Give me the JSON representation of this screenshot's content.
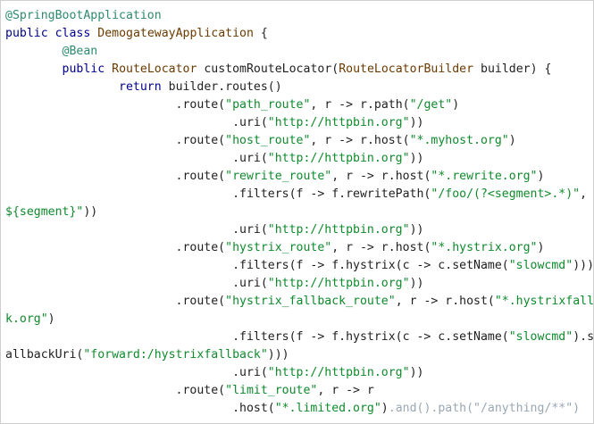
{
  "colors": {
    "annotation": "#2e8a6e",
    "keyword": "#00008b",
    "type": "#6b3a00",
    "string": "#0f8a2c",
    "plain": "#1f1f1f",
    "faded": "#9aa7b2",
    "background": "#ffffff"
  },
  "code": {
    "lines": [
      [
        {
          "t": "annotation",
          "v": "@SpringBootApplication"
        }
      ],
      [
        {
          "t": "keyword",
          "v": "public"
        },
        {
          "t": "plain",
          "v": " "
        },
        {
          "t": "keyword",
          "v": "class"
        },
        {
          "t": "plain",
          "v": " "
        },
        {
          "t": "type",
          "v": "DemogatewayApplication"
        },
        {
          "t": "plain",
          "v": " {"
        }
      ],
      [
        {
          "t": "plain",
          "v": "        "
        },
        {
          "t": "annotation",
          "v": "@Bean"
        }
      ],
      [
        {
          "t": "plain",
          "v": "        "
        },
        {
          "t": "keyword",
          "v": "public"
        },
        {
          "t": "plain",
          "v": " "
        },
        {
          "t": "type",
          "v": "RouteLocator"
        },
        {
          "t": "plain",
          "v": " customRouteLocator("
        },
        {
          "t": "type",
          "v": "RouteLocatorBuilder"
        },
        {
          "t": "plain",
          "v": " builder) {"
        }
      ],
      [
        {
          "t": "plain",
          "v": "                "
        },
        {
          "t": "keyword",
          "v": "return"
        },
        {
          "t": "plain",
          "v": " builder.routes()"
        }
      ],
      [
        {
          "t": "plain",
          "v": "                        .route("
        },
        {
          "t": "string",
          "v": "\"path_route\""
        },
        {
          "t": "plain",
          "v": ", r -> r.path("
        },
        {
          "t": "string",
          "v": "\"/get\""
        },
        {
          "t": "plain",
          "v": ")"
        }
      ],
      [
        {
          "t": "plain",
          "v": "                                .uri("
        },
        {
          "t": "string",
          "v": "\"http://httpbin.org\""
        },
        {
          "t": "plain",
          "v": "))"
        }
      ],
      [
        {
          "t": "plain",
          "v": "                        .route("
        },
        {
          "t": "string",
          "v": "\"host_route\""
        },
        {
          "t": "plain",
          "v": ", r -> r.host("
        },
        {
          "t": "string",
          "v": "\"*.myhost.org\""
        },
        {
          "t": "plain",
          "v": ")"
        }
      ],
      [
        {
          "t": "plain",
          "v": "                                .uri("
        },
        {
          "t": "string",
          "v": "\"http://httpbin.org\""
        },
        {
          "t": "plain",
          "v": "))"
        }
      ],
      [
        {
          "t": "plain",
          "v": "                        .route("
        },
        {
          "t": "string",
          "v": "\"rewrite_route\""
        },
        {
          "t": "plain",
          "v": ", r -> r.host("
        },
        {
          "t": "string",
          "v": "\"*.rewrite.org\""
        },
        {
          "t": "plain",
          "v": ")"
        }
      ],
      [
        {
          "t": "plain",
          "v": "                                .filters(f -> f.rewritePath("
        },
        {
          "t": "string",
          "v": "\"/foo/(?<segment>.*)\""
        },
        {
          "t": "plain",
          "v": ","
        }
      ],
      [
        {
          "t": "string",
          "v": "${segment}\""
        },
        {
          "t": "plain",
          "v": "))"
        }
      ],
      [
        {
          "t": "plain",
          "v": "                                .uri("
        },
        {
          "t": "string",
          "v": "\"http://httpbin.org\""
        },
        {
          "t": "plain",
          "v": "))"
        }
      ],
      [
        {
          "t": "plain",
          "v": "                        .route("
        },
        {
          "t": "string",
          "v": "\"hystrix_route\""
        },
        {
          "t": "plain",
          "v": ", r -> r.host("
        },
        {
          "t": "string",
          "v": "\"*.hystrix.org\""
        },
        {
          "t": "plain",
          "v": ")"
        }
      ],
      [
        {
          "t": "plain",
          "v": "                                .filters(f -> f.hystrix(c -> c.setName("
        },
        {
          "t": "string",
          "v": "\"slowcmd\""
        },
        {
          "t": "plain",
          "v": ")))"
        }
      ],
      [
        {
          "t": "plain",
          "v": "                                .uri("
        },
        {
          "t": "string",
          "v": "\"http://httpbin.org\""
        },
        {
          "t": "plain",
          "v": "))"
        }
      ],
      [
        {
          "t": "plain",
          "v": "                        .route("
        },
        {
          "t": "string",
          "v": "\"hystrix_fallback_route\""
        },
        {
          "t": "plain",
          "v": ", r -> r.host("
        },
        {
          "t": "string",
          "v": "\"*.hystrixfall"
        }
      ],
      [
        {
          "t": "string",
          "v": "k.org\""
        },
        {
          "t": "plain",
          "v": ")"
        }
      ],
      [
        {
          "t": "plain",
          "v": "                                .filters(f -> f.hystrix(c -> c.setName("
        },
        {
          "t": "string",
          "v": "\"slowcmd\""
        },
        {
          "t": "plain",
          "v": ").s"
        }
      ],
      [
        {
          "t": "plain",
          "v": "allbackUri("
        },
        {
          "t": "string",
          "v": "\"forward:/hystrixfallback\""
        },
        {
          "t": "plain",
          "v": ")))"
        }
      ],
      [
        {
          "t": "plain",
          "v": "                                .uri("
        },
        {
          "t": "string",
          "v": "\"http://httpbin.org\""
        },
        {
          "t": "plain",
          "v": "))"
        }
      ],
      [
        {
          "t": "plain",
          "v": "                        .route("
        },
        {
          "t": "string",
          "v": "\"limit_route\""
        },
        {
          "t": "plain",
          "v": ", r -> r"
        }
      ],
      [
        {
          "t": "plain",
          "v": "                                .host("
        },
        {
          "t": "string",
          "v": "\"*.limited.org\""
        },
        {
          "t": "plain",
          "v": ")"
        },
        {
          "t": "faded",
          "v": ".and().path(\"/anything/**\")"
        }
      ]
    ]
  }
}
